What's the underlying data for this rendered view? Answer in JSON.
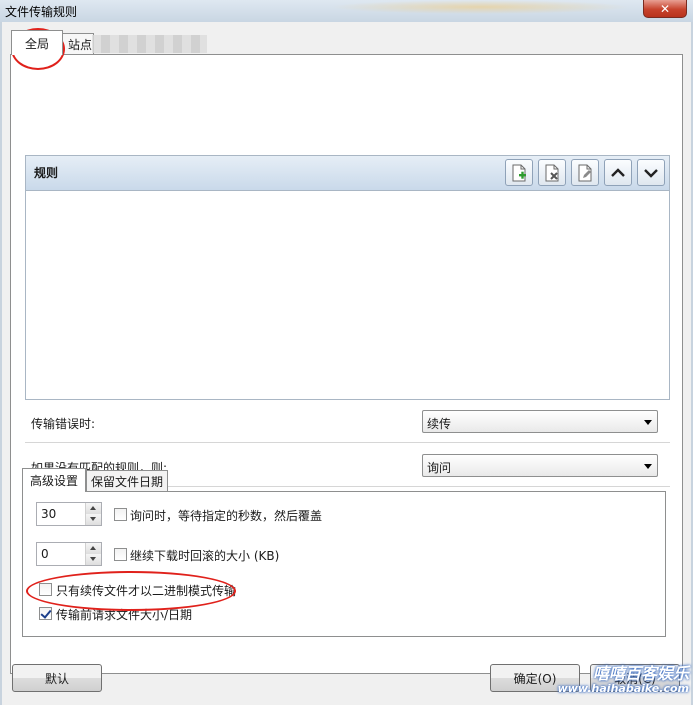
{
  "window": {
    "title": "文件传输规则",
    "close_label": "✕"
  },
  "tabs": [
    {
      "label": "全局"
    },
    {
      "label": "站点"
    }
  ],
  "rules": {
    "header": "规则",
    "toolbar": [
      "add-rule-icon",
      "delete-rule-icon",
      "edit-rule-icon",
      "move-up-icon",
      "move-down-icon"
    ]
  },
  "form": {
    "transfer_error_label": "传输错误时:",
    "transfer_error_value": "续传",
    "no_match_label": "如果没有匹配的规则，则:",
    "no_match_value": "询问"
  },
  "inner_tabs": [
    {
      "label": "高级设置"
    },
    {
      "label": "保留文件日期"
    }
  ],
  "advanced": {
    "wait_seconds_value": "30",
    "wait_seconds_label": "询问时，等待指定的秒数，然后覆盖",
    "wait_seconds_checked": false,
    "rollback_value": "0",
    "rollback_label": "继续下载时回滚的大小 (KB)",
    "rollback_checked": false,
    "binary_only_label": "只有续传文件才以二进制模式传输",
    "binary_only_checked": false,
    "request_size_label": "传输前请求文件大小/日期",
    "request_size_checked": true
  },
  "buttons": {
    "default_label": "默认",
    "ok_label": "确定(O)",
    "cancel_label": "取消(C)"
  },
  "watermark": {
    "text": "嘻嘻百客娱乐",
    "url": "www.haihabaike.com"
  },
  "colors": {
    "annotation": "#e0211b",
    "close_button": "#c7432d",
    "header_gradient": "#c9d9ea"
  }
}
